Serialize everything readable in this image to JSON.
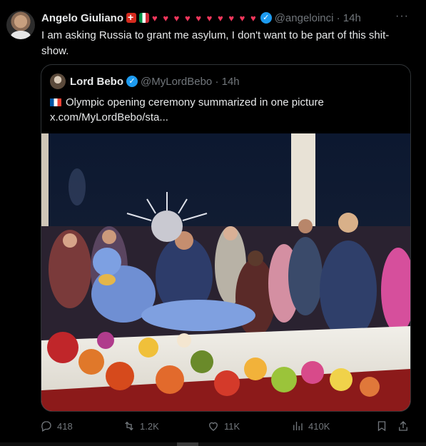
{
  "tweet": {
    "author_name": "Angelo Giuliano",
    "hearts": "♥ ♥ ♥ ♥ ♥ ♥ ♥ ♥ ♥ ♥",
    "handle": "@angeloinci · 14h",
    "more": "···",
    "text": "I am asking Russia to grant me asylum, I don't want to be part of this shit-show."
  },
  "quote": {
    "author_name": "Lord Bebo",
    "handle": "@MyLordBebo · 14h",
    "text_line1": "Olympic opening ceremony summarized in one picture",
    "text_line2": "x.com/MyLordBebo/sta..."
  },
  "actions": {
    "replies": "418",
    "reposts": "1.2K",
    "likes": "11K",
    "views": "410K"
  },
  "colors": {
    "background": "#000000",
    "text": "#e7e9ea",
    "muted": "#71767b",
    "verified": "#1d9bf0",
    "heart": "#f4375c"
  },
  "icons": [
    "reply-icon",
    "repost-icon",
    "like-icon",
    "views-icon",
    "bookmark-icon",
    "share-icon",
    "verified-badge-icon",
    "more-icon"
  ]
}
